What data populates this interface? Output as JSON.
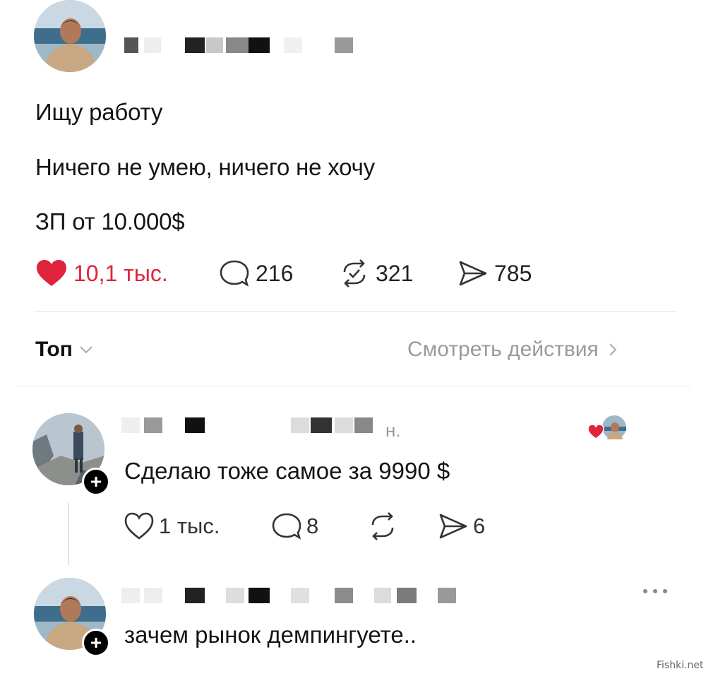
{
  "post": {
    "lines": [
      "Ищу работу",
      "Ничего не умею, ничего не хочу",
      "ЗП от 10.000$"
    ],
    "stats": {
      "likes": "10,1 тыс.",
      "comments": "216",
      "reposts": "321",
      "shares": "785"
    }
  },
  "sort": {
    "label": "Топ",
    "view_activity": "Смотреть действия"
  },
  "comments": [
    {
      "time": "н.",
      "text": "Сделаю тоже самое за 9990 $",
      "stats": {
        "likes": "1 тыс.",
        "comments": "8",
        "shares": "6"
      }
    },
    {
      "text": "зачем рынок демпингуете.."
    }
  ],
  "watermark": "Fishki.net",
  "colors": {
    "like_red": "#e0243c",
    "muted": "#9a9a9a"
  },
  "icons": [
    "heart-icon",
    "comment-bubble-icon",
    "repost-icon",
    "share-icon",
    "chevron-down-icon",
    "chevron-right-icon",
    "plus-icon",
    "more-icon"
  ]
}
